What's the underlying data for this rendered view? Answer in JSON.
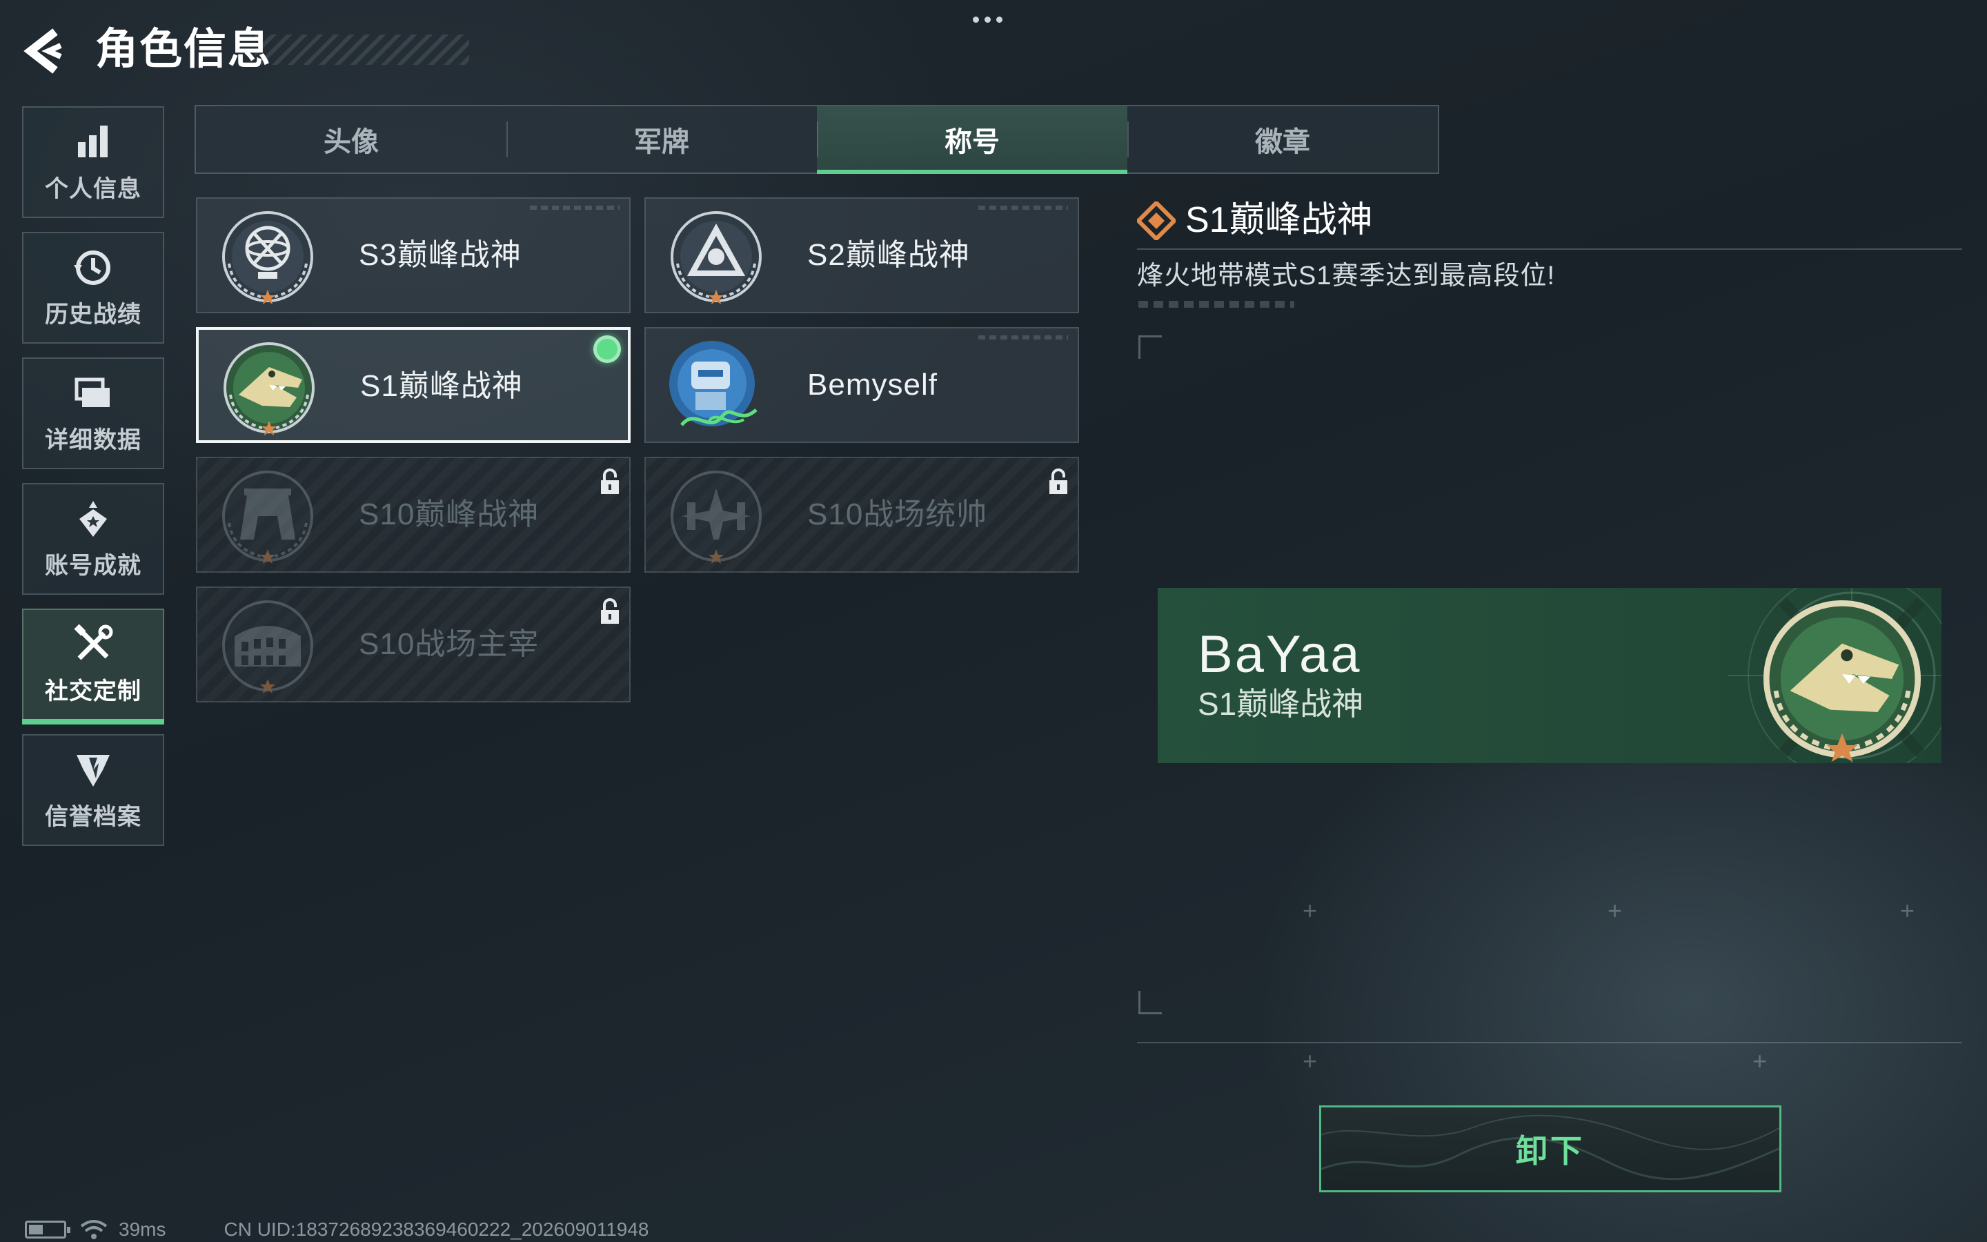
{
  "header": {
    "title": "角色信息",
    "back_icon": "back-arrow-icon",
    "more_icon": "more-dots-icon"
  },
  "sidebar": {
    "items": [
      {
        "label": "个人信息",
        "icon": "bar-chart-icon",
        "active": false
      },
      {
        "label": "历史战绩",
        "icon": "history-clock-icon",
        "active": false
      },
      {
        "label": "详细数据",
        "icon": "folders-icon",
        "active": false
      },
      {
        "label": "账号成就",
        "icon": "achievement-medal-icon",
        "active": false
      },
      {
        "label": "社交定制",
        "icon": "tools-icon",
        "active": true
      },
      {
        "label": "信誉档案",
        "icon": "credit-shield-icon",
        "active": false
      }
    ]
  },
  "tabs": [
    {
      "label": "头像",
      "active": false
    },
    {
      "label": "军牌",
      "active": false
    },
    {
      "label": "称号",
      "active": true
    },
    {
      "label": "徽章",
      "active": false
    }
  ],
  "titles": [
    {
      "name": "S3巅峰战神",
      "emblem": "globe-trophy-emblem",
      "locked": false,
      "selected": false
    },
    {
      "name": "S2巅峰战神",
      "emblem": "triangle-r-emblem",
      "locked": false,
      "selected": false
    },
    {
      "name": "S1巅峰战神",
      "emblem": "crocodile-emblem",
      "locked": false,
      "selected": true,
      "equipped": true
    },
    {
      "name": "Bemyself",
      "emblem": "robot-signature-emblem",
      "locked": false,
      "selected": false
    },
    {
      "name": "S10巅峰战神",
      "emblem": "gate-emblem",
      "locked": true,
      "selected": false
    },
    {
      "name": "S10战场统帅",
      "emblem": "aircraft-emblem",
      "locked": true,
      "selected": false
    },
    {
      "name": "S10战场主宰",
      "emblem": "colosseum-emblem",
      "locked": true,
      "selected": false
    }
  ],
  "detail": {
    "icon": "diamond-rank-icon",
    "title": "S1巅峰战神",
    "description": "烽火地带模式S1赛季达到最高段位!"
  },
  "preview": {
    "player_name": "BaYaa",
    "title": "S1巅峰战神",
    "emblem": "crocodile-emblem"
  },
  "actions": {
    "unequip_label": "卸下"
  },
  "status_bar": {
    "ping": "39ms",
    "uid": "CN UID:18372689238369460222_202609011948"
  },
  "colors": {
    "accent_green": "#5fcf8f",
    "preview_bg": "#25503c",
    "emblem_gold": "#d9c48a",
    "star_orange": "#d98a4a"
  }
}
